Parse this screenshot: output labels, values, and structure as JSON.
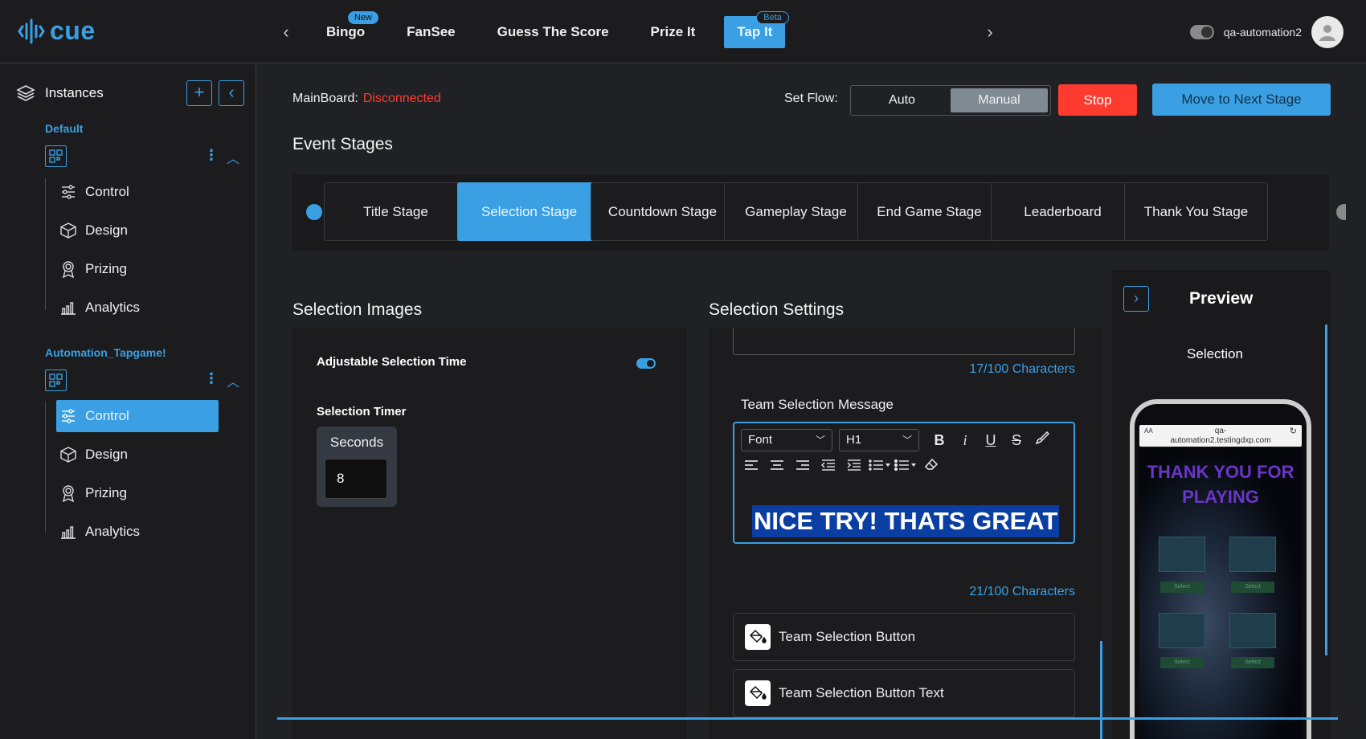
{
  "brand": {
    "name": "cue",
    "accent": "#3aa0e3"
  },
  "topnav": {
    "prev_icon": "chevron-left-icon",
    "next_icon": "chevron-right-icon",
    "tabs": [
      {
        "label": "Bingo",
        "badge": "New"
      },
      {
        "label": "FanSee",
        "badge": ""
      },
      {
        "label": "Guess The Score",
        "badge": ""
      },
      {
        "label": "Prize It",
        "badge": ""
      },
      {
        "label": "Tap It",
        "badge": "Beta",
        "active": true
      }
    ],
    "username": "qa-automation2"
  },
  "sidebar": {
    "title": "Instances",
    "instances": [
      {
        "name": "Default",
        "items": [
          "Control",
          "Design",
          "Prizing",
          "Analytics"
        ]
      },
      {
        "name": "Automation_Tapgame!",
        "items": [
          "Control",
          "Design",
          "Prizing",
          "Analytics"
        ],
        "active_item": "Control"
      }
    ]
  },
  "header": {
    "mainboard_label": "MainBoard:",
    "mainboard_status": "Disconnected",
    "setflow_label": "Set Flow:",
    "flow_options": [
      "Auto",
      "Manual"
    ],
    "flow_selected": "Manual",
    "stop_label": "Stop",
    "next_stage_label": "Move to Next Stage",
    "status_color": "#ff3b30"
  },
  "event_stages": {
    "title": "Event Stages",
    "stages": [
      "Title Stage",
      "Selection Stage",
      "Countdown Stage",
      "Gameplay Stage",
      "End Game Stage",
      "Leaderboard",
      "Thank You Stage"
    ],
    "active": "Selection Stage"
  },
  "selection_images": {
    "title": "Selection Images",
    "adjustable_label": "Adjustable Selection Time",
    "adjustable_on": true,
    "timer_label": "Selection Timer",
    "timer_unit": "Seconds",
    "timer_value": "8"
  },
  "selection_settings": {
    "title": "Selection Settings",
    "prev_char_count": "17/100 Characters",
    "team_message_label": "Team Selection Message",
    "font_select": "Font",
    "heading_select": "H1",
    "message_text": "NICE TRY! THATS GREAT",
    "message_char_count": "21/100 Characters",
    "cards": [
      "Team Selection Button",
      "Team Selection Button Text"
    ]
  },
  "preview": {
    "title": "Preview",
    "subtitle": "Selection",
    "url_line1": "AA",
    "url_line2": "qa-",
    "url_line3": "automation2.testingdxp.com",
    "screen_text": "THANK YOU FOR PLAYING",
    "select_label": "Select"
  }
}
